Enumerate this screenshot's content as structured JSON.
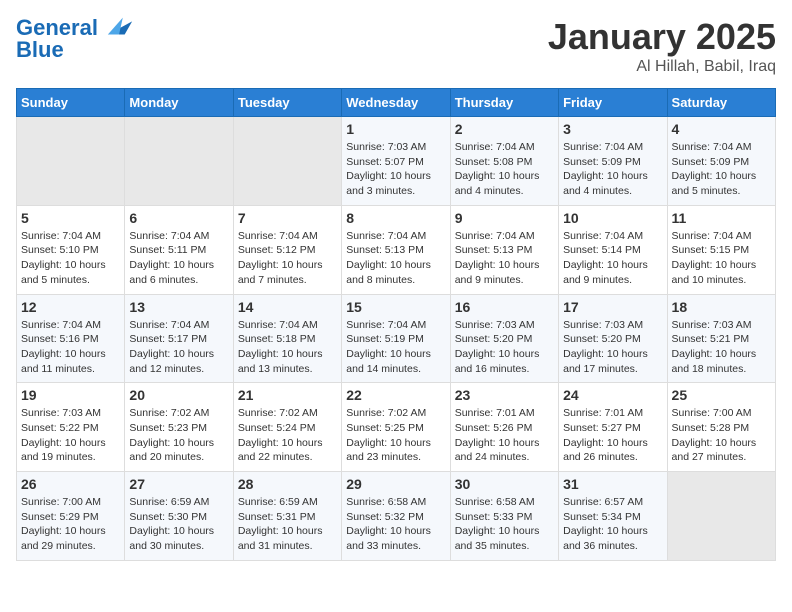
{
  "header": {
    "logo_line1": "General",
    "logo_line2": "Blue",
    "main_title": "January 2025",
    "sub_title": "Al Hillah, Babil, Iraq"
  },
  "columns": [
    "Sunday",
    "Monday",
    "Tuesday",
    "Wednesday",
    "Thursday",
    "Friday",
    "Saturday"
  ],
  "rows": [
    [
      {
        "day": "",
        "sunrise": "",
        "sunset": "",
        "daylight": "",
        "empty": true
      },
      {
        "day": "",
        "sunrise": "",
        "sunset": "",
        "daylight": "",
        "empty": true
      },
      {
        "day": "",
        "sunrise": "",
        "sunset": "",
        "daylight": "",
        "empty": true
      },
      {
        "day": "1",
        "sunrise": "Sunrise: 7:03 AM",
        "sunset": "Sunset: 5:07 PM",
        "daylight": "Daylight: 10 hours and 3 minutes."
      },
      {
        "day": "2",
        "sunrise": "Sunrise: 7:04 AM",
        "sunset": "Sunset: 5:08 PM",
        "daylight": "Daylight: 10 hours and 4 minutes."
      },
      {
        "day": "3",
        "sunrise": "Sunrise: 7:04 AM",
        "sunset": "Sunset: 5:09 PM",
        "daylight": "Daylight: 10 hours and 4 minutes."
      },
      {
        "day": "4",
        "sunrise": "Sunrise: 7:04 AM",
        "sunset": "Sunset: 5:09 PM",
        "daylight": "Daylight: 10 hours and 5 minutes."
      }
    ],
    [
      {
        "day": "5",
        "sunrise": "Sunrise: 7:04 AM",
        "sunset": "Sunset: 5:10 PM",
        "daylight": "Daylight: 10 hours and 5 minutes."
      },
      {
        "day": "6",
        "sunrise": "Sunrise: 7:04 AM",
        "sunset": "Sunset: 5:11 PM",
        "daylight": "Daylight: 10 hours and 6 minutes."
      },
      {
        "day": "7",
        "sunrise": "Sunrise: 7:04 AM",
        "sunset": "Sunset: 5:12 PM",
        "daylight": "Daylight: 10 hours and 7 minutes."
      },
      {
        "day": "8",
        "sunrise": "Sunrise: 7:04 AM",
        "sunset": "Sunset: 5:13 PM",
        "daylight": "Daylight: 10 hours and 8 minutes."
      },
      {
        "day": "9",
        "sunrise": "Sunrise: 7:04 AM",
        "sunset": "Sunset: 5:13 PM",
        "daylight": "Daylight: 10 hours and 9 minutes."
      },
      {
        "day": "10",
        "sunrise": "Sunrise: 7:04 AM",
        "sunset": "Sunset: 5:14 PM",
        "daylight": "Daylight: 10 hours and 9 minutes."
      },
      {
        "day": "11",
        "sunrise": "Sunrise: 7:04 AM",
        "sunset": "Sunset: 5:15 PM",
        "daylight": "Daylight: 10 hours and 10 minutes."
      }
    ],
    [
      {
        "day": "12",
        "sunrise": "Sunrise: 7:04 AM",
        "sunset": "Sunset: 5:16 PM",
        "daylight": "Daylight: 10 hours and 11 minutes."
      },
      {
        "day": "13",
        "sunrise": "Sunrise: 7:04 AM",
        "sunset": "Sunset: 5:17 PM",
        "daylight": "Daylight: 10 hours and 12 minutes."
      },
      {
        "day": "14",
        "sunrise": "Sunrise: 7:04 AM",
        "sunset": "Sunset: 5:18 PM",
        "daylight": "Daylight: 10 hours and 13 minutes."
      },
      {
        "day": "15",
        "sunrise": "Sunrise: 7:04 AM",
        "sunset": "Sunset: 5:19 PM",
        "daylight": "Daylight: 10 hours and 14 minutes."
      },
      {
        "day": "16",
        "sunrise": "Sunrise: 7:03 AM",
        "sunset": "Sunset: 5:20 PM",
        "daylight": "Daylight: 10 hours and 16 minutes."
      },
      {
        "day": "17",
        "sunrise": "Sunrise: 7:03 AM",
        "sunset": "Sunset: 5:20 PM",
        "daylight": "Daylight: 10 hours and 17 minutes."
      },
      {
        "day": "18",
        "sunrise": "Sunrise: 7:03 AM",
        "sunset": "Sunset: 5:21 PM",
        "daylight": "Daylight: 10 hours and 18 minutes."
      }
    ],
    [
      {
        "day": "19",
        "sunrise": "Sunrise: 7:03 AM",
        "sunset": "Sunset: 5:22 PM",
        "daylight": "Daylight: 10 hours and 19 minutes."
      },
      {
        "day": "20",
        "sunrise": "Sunrise: 7:02 AM",
        "sunset": "Sunset: 5:23 PM",
        "daylight": "Daylight: 10 hours and 20 minutes."
      },
      {
        "day": "21",
        "sunrise": "Sunrise: 7:02 AM",
        "sunset": "Sunset: 5:24 PM",
        "daylight": "Daylight: 10 hours and 22 minutes."
      },
      {
        "day": "22",
        "sunrise": "Sunrise: 7:02 AM",
        "sunset": "Sunset: 5:25 PM",
        "daylight": "Daylight: 10 hours and 23 minutes."
      },
      {
        "day": "23",
        "sunrise": "Sunrise: 7:01 AM",
        "sunset": "Sunset: 5:26 PM",
        "daylight": "Daylight: 10 hours and 24 minutes."
      },
      {
        "day": "24",
        "sunrise": "Sunrise: 7:01 AM",
        "sunset": "Sunset: 5:27 PM",
        "daylight": "Daylight: 10 hours and 26 minutes."
      },
      {
        "day": "25",
        "sunrise": "Sunrise: 7:00 AM",
        "sunset": "Sunset: 5:28 PM",
        "daylight": "Daylight: 10 hours and 27 minutes."
      }
    ],
    [
      {
        "day": "26",
        "sunrise": "Sunrise: 7:00 AM",
        "sunset": "Sunset: 5:29 PM",
        "daylight": "Daylight: 10 hours and 29 minutes."
      },
      {
        "day": "27",
        "sunrise": "Sunrise: 6:59 AM",
        "sunset": "Sunset: 5:30 PM",
        "daylight": "Daylight: 10 hours and 30 minutes."
      },
      {
        "day": "28",
        "sunrise": "Sunrise: 6:59 AM",
        "sunset": "Sunset: 5:31 PM",
        "daylight": "Daylight: 10 hours and 31 minutes."
      },
      {
        "day": "29",
        "sunrise": "Sunrise: 6:58 AM",
        "sunset": "Sunset: 5:32 PM",
        "daylight": "Daylight: 10 hours and 33 minutes."
      },
      {
        "day": "30",
        "sunrise": "Sunrise: 6:58 AM",
        "sunset": "Sunset: 5:33 PM",
        "daylight": "Daylight: 10 hours and 35 minutes."
      },
      {
        "day": "31",
        "sunrise": "Sunrise: 6:57 AM",
        "sunset": "Sunset: 5:34 PM",
        "daylight": "Daylight: 10 hours and 36 minutes."
      },
      {
        "day": "",
        "sunrise": "",
        "sunset": "",
        "daylight": "",
        "empty": true
      }
    ]
  ]
}
